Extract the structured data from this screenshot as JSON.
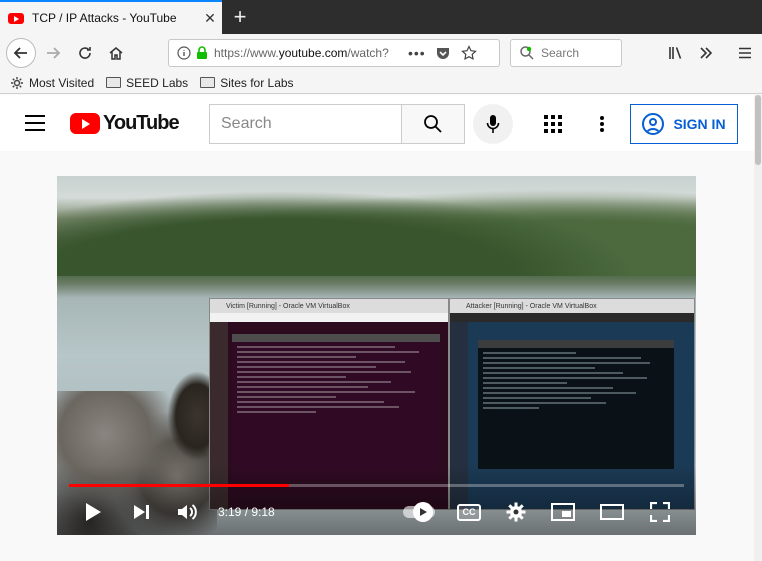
{
  "browser": {
    "tab_title": "TCP / IP Attacks - YouTube",
    "tab_close": "✕",
    "new_tab": "+",
    "url_prefix": "https://www.",
    "url_domain": "youtube.com",
    "url_suffix": "/watch?",
    "search_placeholder": "Search",
    "bookmarks": [
      {
        "label": "Most Visited"
      },
      {
        "label": "SEED Labs"
      },
      {
        "label": "Sites for Labs"
      }
    ]
  },
  "youtube": {
    "logo_text": "YouTube",
    "search_placeholder": "Search",
    "signin_label": "SIGN IN"
  },
  "video": {
    "victim_window_title": "Victim [Running] - Oracle VM VirtualBox",
    "attacker_window_title": "Attacker [Running] - Oracle VM VirtualBox",
    "time_display": "3:19 / 9:18",
    "progress_fraction": 0.357,
    "cc_label": "CC"
  },
  "colors": {
    "youtube_red": "#ff0000",
    "signin_blue": "#065fd4",
    "tab_accent": "#0a84ff"
  }
}
